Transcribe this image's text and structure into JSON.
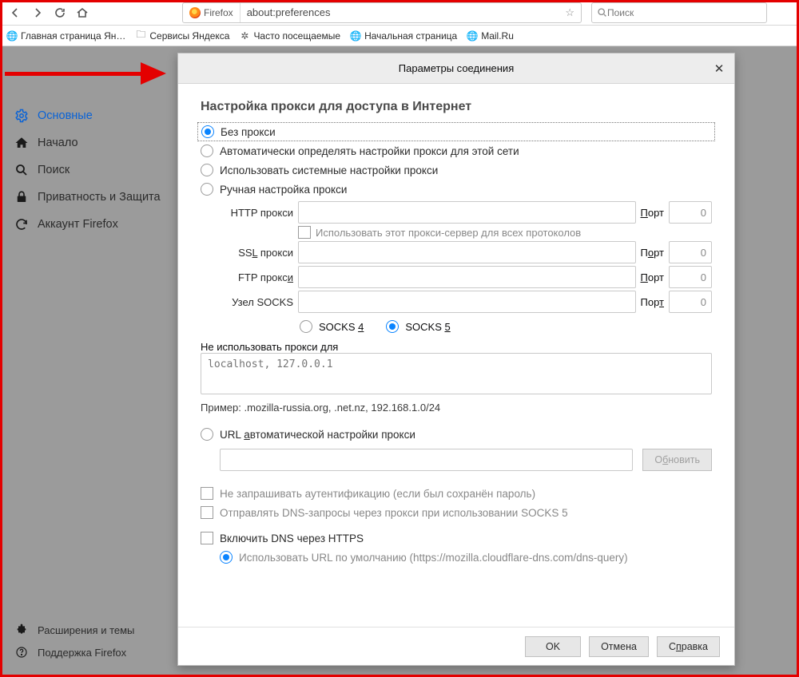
{
  "toolbar": {
    "identity": "Firefox",
    "url": "about:preferences",
    "search_placeholder": "Поиск"
  },
  "bookmarks": [
    "Главная страница Ян…",
    "Сервисы Яндекса",
    "Часто посещаемые",
    "Начальная страница",
    "Mail.Ru"
  ],
  "sidebar": {
    "items": [
      {
        "label": "Основные"
      },
      {
        "label": "Начало"
      },
      {
        "label": "Поиск"
      },
      {
        "label": "Приватность и Защита"
      },
      {
        "label": "Аккаунт Firefox"
      }
    ],
    "bottom": [
      {
        "label": "Расширения и темы"
      },
      {
        "label": "Поддержка Firefox"
      }
    ]
  },
  "dialog": {
    "title": "Параметры соединения",
    "section_title": "Настройка прокси для доступа в Интернет",
    "radios": {
      "no_proxy": "Без прокси",
      "auto_detect": "Автоматически определять настройки прокси для этой сети",
      "system": "Использовать системные настройки прокси",
      "manual": "Ручная настройка прокси",
      "auto_url": "URL автоматической настройки прокси"
    },
    "proxy_labels": {
      "http": "HTTP прокси",
      "ssl": "SSL прокси",
      "ftp": "FTP прокси",
      "socks": "Узел SOCKS",
      "port": "Порт",
      "port_u": "Порт",
      "use_for_all": "Использовать этот прокси-сервер для всех протоколов",
      "socks4": "SOCKS 4",
      "socks5": "SOCKS 5"
    },
    "port_default": "0",
    "no_proxy_for": "Не использовать прокси для",
    "no_proxy_placeholder": "localhost, 127.0.0.1",
    "no_proxy_hint": "Пример: .mozilla-russia.org, .net.nz, 192.168.1.0/24",
    "reload_btn": "Обновить",
    "checks": {
      "no_auth": "Не запрашивать аутентификацию (если был сохранён пароль)",
      "dns_socks5": "Отправлять DNS-запросы через прокси при использовании SOCKS 5",
      "dns_https": "Включить DNS через HTTPS",
      "use_default_url": "Использовать URL по умолчанию (https://mozilla.cloudflare-dns.com/dns-query)"
    },
    "buttons": {
      "ok": "OK",
      "cancel": "Отмена",
      "help": "Справка"
    }
  }
}
